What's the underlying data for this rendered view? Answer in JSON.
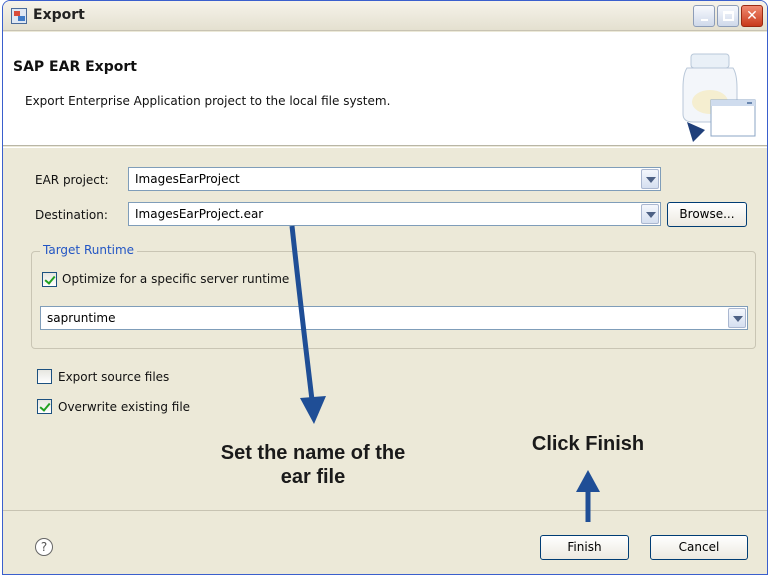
{
  "window": {
    "title": "Export"
  },
  "header": {
    "title": "SAP EAR Export",
    "description": "Export Enterprise Application project to the local file system."
  },
  "form": {
    "ear_project_label": "EAR project:",
    "ear_project_value": "ImagesEarProject",
    "destination_label": "Destination:",
    "destination_value": "ImagesEarProject.ear",
    "browse_label": "Browse..."
  },
  "target_runtime": {
    "group_title": "Target Runtime",
    "optimize_label": "Optimize for a specific server runtime",
    "optimize_checked": true,
    "runtime_value": "sapruntime"
  },
  "options": {
    "export_source_label": "Export source files",
    "export_source_checked": false,
    "overwrite_label": "Overwrite existing file",
    "overwrite_checked": true
  },
  "annotations": {
    "set_name_line1": "Set the name of the",
    "set_name_line2": "ear file",
    "click_finish": "Click Finish"
  },
  "footer": {
    "help_glyph": "?",
    "finish_label": "Finish",
    "cancel_label": "Cancel"
  },
  "colors": {
    "accent": "#2255c4",
    "arrow": "#1f4e96",
    "dialog_bg": "#ece9d8"
  }
}
